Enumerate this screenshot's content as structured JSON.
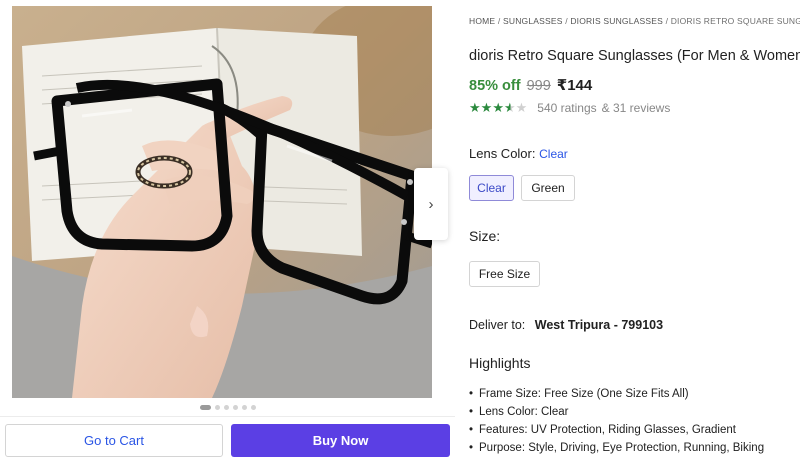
{
  "breadcrumb": [
    "HOME",
    "SUNGLASSES",
    "DIORIS SUNGLASSES",
    "DIORIS RETRO SQUARE SUNGLASSES"
  ],
  "breadcrumb_separator": "/",
  "product": {
    "title": "dioris Retro Square Sunglasses (For Men & Women, Cle",
    "discount": "85% off",
    "mrp": "999",
    "price": "₹144",
    "rating_value": 3.5,
    "ratings_text": "540 ratings",
    "reviews_text": "& 31 reviews"
  },
  "lens_color": {
    "label": "Lens Color:",
    "selected": "Clear",
    "options": [
      "Clear",
      "Green"
    ]
  },
  "size": {
    "label": "Size:",
    "options": [
      "Free Size"
    ]
  },
  "delivery": {
    "label": "Deliver to:",
    "location": "West Tripura - 799103"
  },
  "highlights": {
    "title": "Highlights",
    "items": [
      "Frame Size: Free Size (One Size Fits All)",
      "Lens Color: Clear",
      "Features: UV Protection, Riding Glasses, Gradient",
      "Purpose: Style, Driving, Eye Protection, Running, Biking"
    ]
  },
  "gallery": {
    "next_icon": "chevron-right-icon",
    "image_count": 6,
    "active_index": 0
  },
  "actions": {
    "cart_label": "Go to Cart",
    "buy_label": "Buy Now"
  },
  "colors": {
    "accent": "#2a55e5",
    "buy_button": "#5b3fe4",
    "discount": "#388e3c",
    "star": "#2b8a3e"
  }
}
